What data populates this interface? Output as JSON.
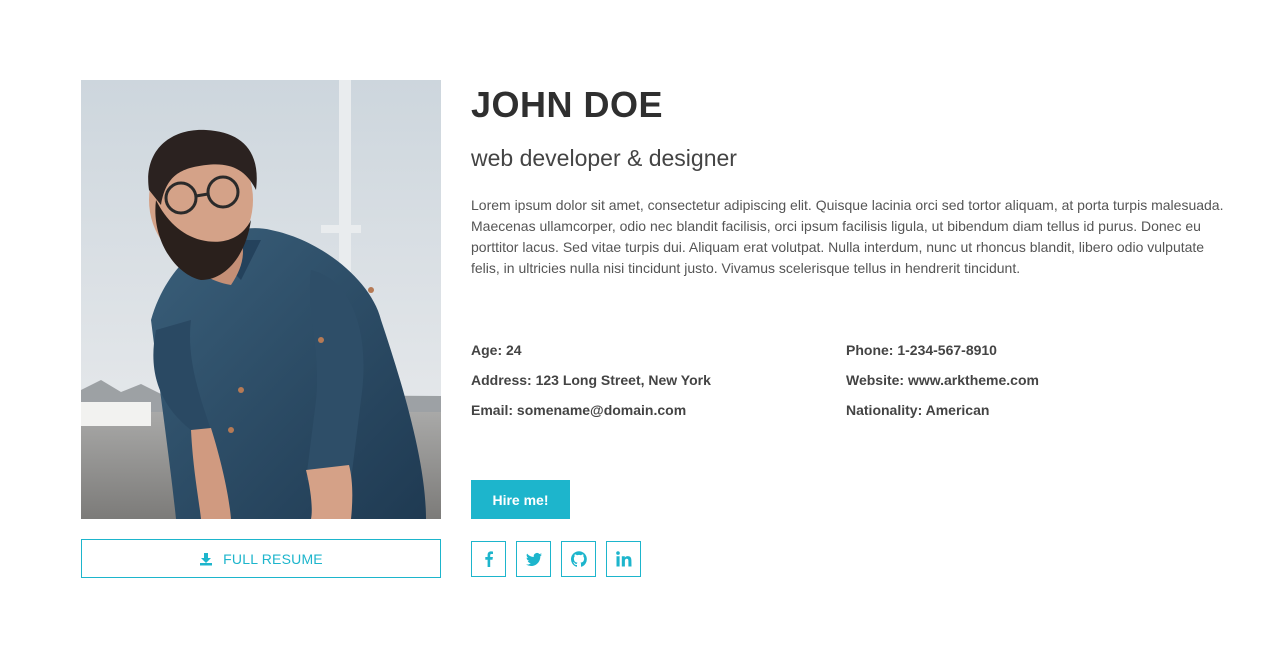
{
  "profile": {
    "name": "JOHN DOE",
    "role": "web developer & designer",
    "bio": "Lorem ipsum dolor sit amet, consectetur adipiscing elit. Quisque lacinia orci sed tortor aliquam, at porta turpis malesuada. Maecenas ullamcorper, odio nec blandit facilisis, orci ipsum facilisis ligula, ut bibendum diam tellus id purus. Donec eu porttitor lacus. Sed vitae turpis dui. Aliquam erat volutpat. Nulla interdum, nunc ut rhoncus blandit, libero odio vulputate felis, in ultricies nulla nisi tincidunt justo. Vivamus scelerisque tellus in hendrerit tincidunt."
  },
  "details": {
    "left": [
      "Age: 24",
      "Address: 123 Long Street, New York",
      "Email: somename@domain.com"
    ],
    "right": [
      "Phone: 1-234-567-8910",
      "Website: www.arktheme.com",
      "Nationality: American"
    ]
  },
  "buttons": {
    "resume": "FULL RESUME",
    "hire": "Hire me!"
  },
  "icons": {
    "resume": "download-icon",
    "socials": [
      "facebook-icon",
      "twitter-icon",
      "github-icon",
      "linkedin-icon"
    ]
  },
  "colors": {
    "accent": "#1db5cc",
    "heading": "#2f2f2f",
    "text": "#555555"
  }
}
